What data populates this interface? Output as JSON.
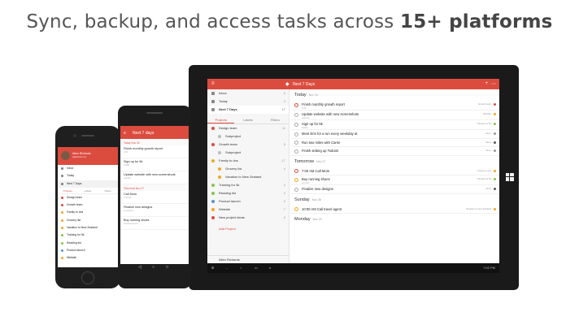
{
  "headline": {
    "normal": "Sync, backup, and access tasks across ",
    "bold": "15+ platforms"
  },
  "tablet": {
    "header_title": "Next 7 Days",
    "nav": [
      {
        "label": "Inbox",
        "count": "5"
      },
      {
        "label": "Today",
        "count": "3"
      },
      {
        "label": "Next 7 Days",
        "count": "17"
      }
    ],
    "tabs": [
      "Projects",
      "Labels",
      "Filters"
    ],
    "projects": [
      {
        "label": "Design team",
        "color": "#db4c3f",
        "count": "11"
      },
      {
        "label": "Subproject",
        "color": "#bbbbbb",
        "count": "",
        "indent": true
      },
      {
        "label": "Growth team",
        "color": "#db4c3f",
        "count": "5"
      },
      {
        "label": "Subproject",
        "color": "#bbbbbb",
        "count": "",
        "indent": true
      },
      {
        "label": "Family to dos",
        "color": "#f5a623",
        "count": "17"
      },
      {
        "label": "Grocery list",
        "color": "#f5a623",
        "count": "4",
        "indent": true
      },
      {
        "label": "Vacation to New Zealand",
        "color": "#f5a623",
        "count": "",
        "indent": true
      },
      {
        "label": "Training for 5k",
        "color": "#8bc34a",
        "count": "4"
      },
      {
        "label": "Reading list",
        "color": "#8bc34a",
        "count": "3"
      },
      {
        "label": "Product launch",
        "color": "#5297d6",
        "count": "3"
      },
      {
        "label": "Website",
        "color": "#f5a623",
        "count": "7"
      },
      {
        "label": "New project ideas",
        "color": "#db4c3f",
        "count": "3"
      }
    ],
    "add_project": "Add Project",
    "user": "Allen Richards",
    "sections": [
      {
        "title": "Today",
        "date": "Nov 26",
        "tasks": [
          {
            "text": "Finish monthly growth report",
            "sub": "2:20",
            "project": "Growth team",
            "color": "#db4c3f",
            "check": "red"
          },
          {
            "text": "Update website with new screenshots",
            "sub": "website",
            "project": "Website",
            "color": "#f5a623",
            "check": ""
          },
          {
            "text": "Sign up for 5k",
            "sub": "health",
            "project": "Training for 5k",
            "color": "#8bc34a",
            "check": ""
          },
          {
            "text": "Meet Erin for a run every weekday at",
            "sub": "",
            "project": "Inbox",
            "color": "#999999",
            "check": ""
          },
          {
            "text": "Run two miles with Carrie",
            "sub": "",
            "project": "Inbox",
            "color": "#555555",
            "check": ""
          },
          {
            "text": "Finish setting up Todoist",
            "sub": "",
            "project": "Inbox",
            "color": "#999999",
            "check": ""
          }
        ]
      },
      {
        "title": "Tomorrow",
        "date": "Nov 27",
        "tasks": [
          {
            "text": "7:00 AM  Call Mom",
            "sub": "",
            "project": "Family to dos",
            "color": "#f5a623",
            "check": "red"
          },
          {
            "text": "Buy running shoes",
            "sub": "errands",
            "project": "Training for 5k",
            "color": "#8bc34a",
            "check": "org"
          },
          {
            "text": "Finalize new designs",
            "sub": "",
            "project": "Inbox",
            "color": "#555555",
            "check": ""
          }
        ]
      },
      {
        "title": "Sunday",
        "date": "Nov 28",
        "tasks": [
          {
            "text": "10:00 AM  Call travel agent",
            "sub": "",
            "project": "Vacation to New Zealand",
            "color": "#f5a623",
            "check": "org"
          }
        ]
      },
      {
        "title": "Monday",
        "date": "Nov 29",
        "tasks": []
      }
    ],
    "taskbar_time": "7:02 PM"
  },
  "android": {
    "header_title": "Next 7 days",
    "sections": [
      {
        "title": "Today  Nov 26",
        "tasks": [
          {
            "text": "Finish monthly growth report",
            "sub": "2:20"
          },
          {
            "text": "Sign up for 5k",
            "sub": "health"
          },
          {
            "text": "Update website with new screenshots",
            "sub": "website"
          }
        ]
      },
      {
        "title": "Tomorrow  Nov 27",
        "tasks": [
          {
            "text": "Call Mom",
            "sub": "7:00 AM"
          },
          {
            "text": "Finalize new designs",
            "sub": "#_projects"
          },
          {
            "text": "Buy running shoes",
            "sub": "Product launch"
          }
        ]
      }
    ]
  },
  "iphone": {
    "user_name": "Allen Richards",
    "user_email": "a@todoist.com",
    "nav": [
      "Inbox",
      "Today",
      "Next 7 Days"
    ],
    "tabs": [
      "Projects",
      "Labels",
      "Filters"
    ],
    "projects": [
      {
        "label": "Design team",
        "color": "#db4c3f"
      },
      {
        "label": "Growth team",
        "color": "#db4c3f"
      },
      {
        "label": "Family to dos",
        "color": "#f5a623"
      },
      {
        "label": "Grocery list",
        "color": "#f5a623"
      },
      {
        "label": "Vacation to New Zealand",
        "color": "#f5a623"
      },
      {
        "label": "Training for 5k",
        "color": "#8bc34a"
      },
      {
        "label": "Reading list",
        "color": "#8bc34a"
      },
      {
        "label": "Product launch",
        "color": "#5297d6"
      },
      {
        "label": "Website",
        "color": "#f5a623"
      }
    ]
  }
}
